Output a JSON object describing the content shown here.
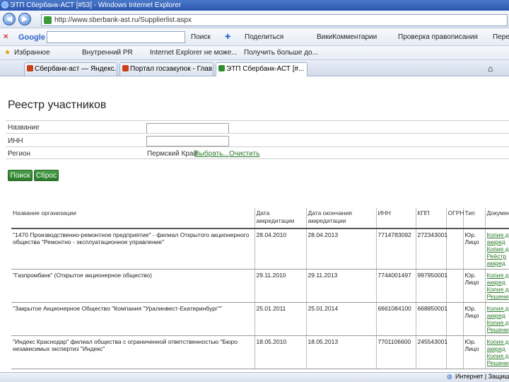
{
  "window": {
    "title": "ЭТП Сбербанк-АСТ [#53] - Windows Internet Explorer",
    "url": "http://www.sberbank-ast.ru/Supplierlist.aspx"
  },
  "google_bar": {
    "logo": "Google",
    "search_button": "Поиск",
    "items": [
      "Поделиться",
      "ВикиКомментарии",
      "Проверка правописания",
      "Пере"
    ]
  },
  "favorites_bar": {
    "favorites_label": "Избранное",
    "links": [
      "Внутренний PR",
      "Internet Explorer не може...",
      "Получить больше до..."
    ]
  },
  "tabs": [
    {
      "label": "Сбербанк-аст — Яндекс...",
      "active": false
    },
    {
      "label": "Портал госзакупок - Глав...",
      "active": false
    },
    {
      "label": "ЭТП Сбербанк-АСТ [#...",
      "active": true
    }
  ],
  "page": {
    "title": "Реестр участников",
    "form": {
      "name_label": "Название",
      "inn_label": "ИНН",
      "region_label": "Регион",
      "region_value": "Пермский Край",
      "select_link": "Выбрать...",
      "clear_link": "Очистить",
      "search_button": "Поиск",
      "reset_button": "Сброс"
    },
    "table": {
      "headers": [
        "Название организации",
        "Дата аккредитации",
        "Дата окончания аккредитации",
        "ИНН",
        "КПП",
        "ОГРН",
        "Тип",
        "Документы"
      ],
      "rows": [
        {
          "name": "\"1470 Производственно-ремонтное предприятие\" - филиал Открытого акционерного общества \"Ремонтно - эксплуатационное управление\"",
          "acc_date": "28.04.2010",
          "acc_end": "28.04.2013",
          "inn": "7714783092",
          "kpp": "272343001",
          "ogrn": "",
          "type": "Юр. Лицо",
          "docs": [
            "Копия д",
            "аккред",
            "Копия д",
            "Реёстр",
            "аккред"
          ]
        },
        {
          "name": "\"Газпромбанк\" (Открытое акционерное общество)",
          "acc_date": "29.11.2010",
          "acc_end": "29.11.2013",
          "inn": "7744001497",
          "kpp": "997950001",
          "ogrn": "",
          "type": "Юр. Лицо",
          "docs": [
            "Копия д",
            "аккред",
            "Копия д",
            "Решени"
          ]
        },
        {
          "name": "\"Закрытое Акционерное Общество \"Компания \"Уралинвест-Екатеринбург\"\"",
          "acc_date": "25.01.2011",
          "acc_end": "25.01.2014",
          "inn": "6661084100",
          "kpp": "668850001",
          "ogrn": "",
          "type": "Юр. Лицо",
          "docs": [
            "Копия д",
            "аккред",
            "Копия д",
            "Решени"
          ]
        },
        {
          "name": "\"Индекс Краснодар\" филиал общества с ограниченной ответственностью \"Бюро независимых экспертиз \"Индекс\"",
          "acc_date": "18.05.2010",
          "acc_end": "18.05.2013",
          "inn": "7701106600",
          "kpp": "245543001",
          "ogrn": "",
          "type": "Юр. Лицо",
          "docs": [
            "Копия д",
            "аккред",
            "Копия д",
            "Решени"
          ]
        }
      ]
    }
  },
  "status_bar": {
    "zone": "Интернет | Защищ"
  }
}
